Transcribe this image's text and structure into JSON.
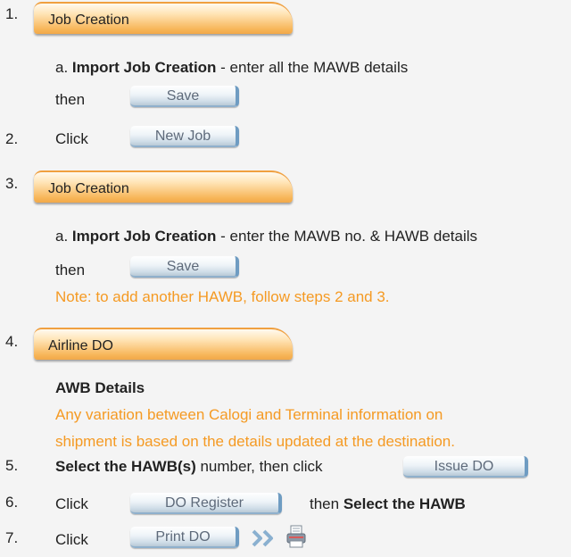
{
  "steps": {
    "s1": {
      "num": "1.",
      "tab": "Job Creation"
    },
    "s1a": {
      "letter": "a.",
      "bold": "Import Job Creation",
      "rest": " - enter all the MAWB details"
    },
    "s1then": {
      "then": "then",
      "button": "Save"
    },
    "s2": {
      "num": "2.",
      "click": "Click",
      "button": "New Job"
    },
    "s3": {
      "num": "3.",
      "tab": "Job Creation"
    },
    "s3a": {
      "letter": "a.",
      "bold": "Import Job Creation",
      "rest": " - enter the MAWB no. & HAWB details"
    },
    "s3then": {
      "then": "then",
      "button": "Save"
    },
    "s3note": "Note: to add another HAWB, follow steps 2 and 3.",
    "s4": {
      "num": "4.",
      "tab": "Airline DO"
    },
    "s4heading": "AWB Details",
    "s4note1": "Any variation between Calogi and Terminal information on",
    "s4note2": "shipment is based on the details updated at the destination.",
    "s5": {
      "num": "5.",
      "bold": "Select the HAWB(s)",
      "rest": " number, then click",
      "button": "Issue DO"
    },
    "s6": {
      "num": "6.",
      "click": "Click",
      "button": "DO Register",
      "then": "then ",
      "bold": "Select the HAWB"
    },
    "s7": {
      "num": "7.",
      "click": "Click",
      "button": "Print DO"
    }
  },
  "colors": {
    "note": "#f59a23",
    "tab": "#f7b558",
    "button_text": "#5e6a7a"
  },
  "icons": {
    "arrow": "double-chevron-right-icon",
    "printer": "printer-icon"
  }
}
